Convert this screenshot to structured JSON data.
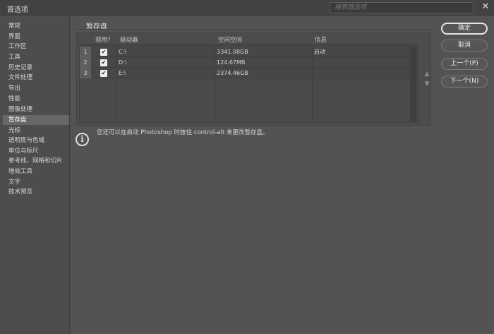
{
  "window": {
    "title": "首选项",
    "search_placeholder": "搜索首选项",
    "close_glyph": "✕"
  },
  "sidebar": {
    "items": [
      {
        "label": "常规"
      },
      {
        "label": "界面"
      },
      {
        "label": "工作区"
      },
      {
        "label": "工具"
      },
      {
        "label": "历史记录"
      },
      {
        "label": "文件处理"
      },
      {
        "label": "导出"
      },
      {
        "label": "性能"
      },
      {
        "label": "图像处理"
      },
      {
        "label": "暂存盘",
        "active": true
      },
      {
        "label": "光标"
      },
      {
        "label": "透明度与色域"
      },
      {
        "label": "单位与标尺"
      },
      {
        "label": "参考线、网格和切片"
      },
      {
        "label": "增效工具"
      },
      {
        "label": "文字"
      },
      {
        "label": "技术预览"
      }
    ]
  },
  "main": {
    "section_title": "暂存盘",
    "columns": {
      "active": "现用?",
      "drive": "驱动器",
      "free_space": "空闲空间",
      "info": "信息"
    },
    "rows": [
      {
        "num": "1",
        "checked": true,
        "drive": "C:\\",
        "free_space": "3341.08GB",
        "info": "启动"
      },
      {
        "num": "2",
        "checked": true,
        "drive": "D:\\",
        "free_space": "124.67MB",
        "info": ""
      },
      {
        "num": "3",
        "checked": true,
        "drive": "E:\\",
        "free_space": "2374.46GB",
        "info": ""
      }
    ],
    "info_icon_glyph": "i",
    "info_text": "您还可以在启动 Photoshop 时按住 control-alt 来更改暂存盘。",
    "move_up_glyph": "▲",
    "move_down_glyph": "▼",
    "check_glyph": "✔"
  },
  "buttons": {
    "ok": "确定",
    "cancel": "取消",
    "prev": "上一个(P)",
    "next": "下一个(N)"
  },
  "colors": {
    "background": "#535353",
    "titlebar": "#424242",
    "sidebar": "#4d4d4d",
    "active_item": "#676767"
  }
}
